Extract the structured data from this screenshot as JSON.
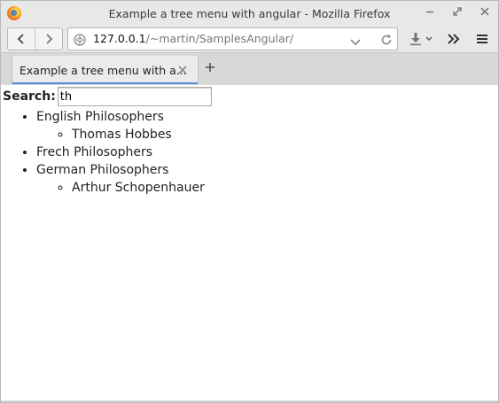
{
  "window": {
    "title": "Example a tree menu with angular - Mozilla Firefox"
  },
  "navbar": {
    "url_host": "127.0.0.1",
    "url_path": "/~martin/SamplesAngular/"
  },
  "tabs": [
    {
      "label": "Example a tree menu with a..."
    }
  ],
  "page": {
    "search_label": "Search:",
    "search_value": "th",
    "tree": [
      {
        "label": "English Philosophers",
        "children": [
          {
            "label": "Thomas Hobbes"
          }
        ]
      },
      {
        "label": "Frech Philosophers",
        "children": []
      },
      {
        "label": "German Philosophers",
        "children": [
          {
            "label": "Arthur Schopenhauer"
          }
        ]
      }
    ]
  },
  "colors": {
    "accent": "#4a90d9",
    "chrome": "#e8e8e7"
  },
  "icons": {
    "window_logo": "firefox-logo",
    "back": "chevron-left",
    "forward": "chevron-right",
    "site_info": "globe-info",
    "url_dropdown": "chevron-down",
    "reload": "reload",
    "downloads": "download-arrow",
    "overflow": "double-chevron",
    "menu": "hamburger",
    "tab_close": "close",
    "new_tab": "plus"
  }
}
